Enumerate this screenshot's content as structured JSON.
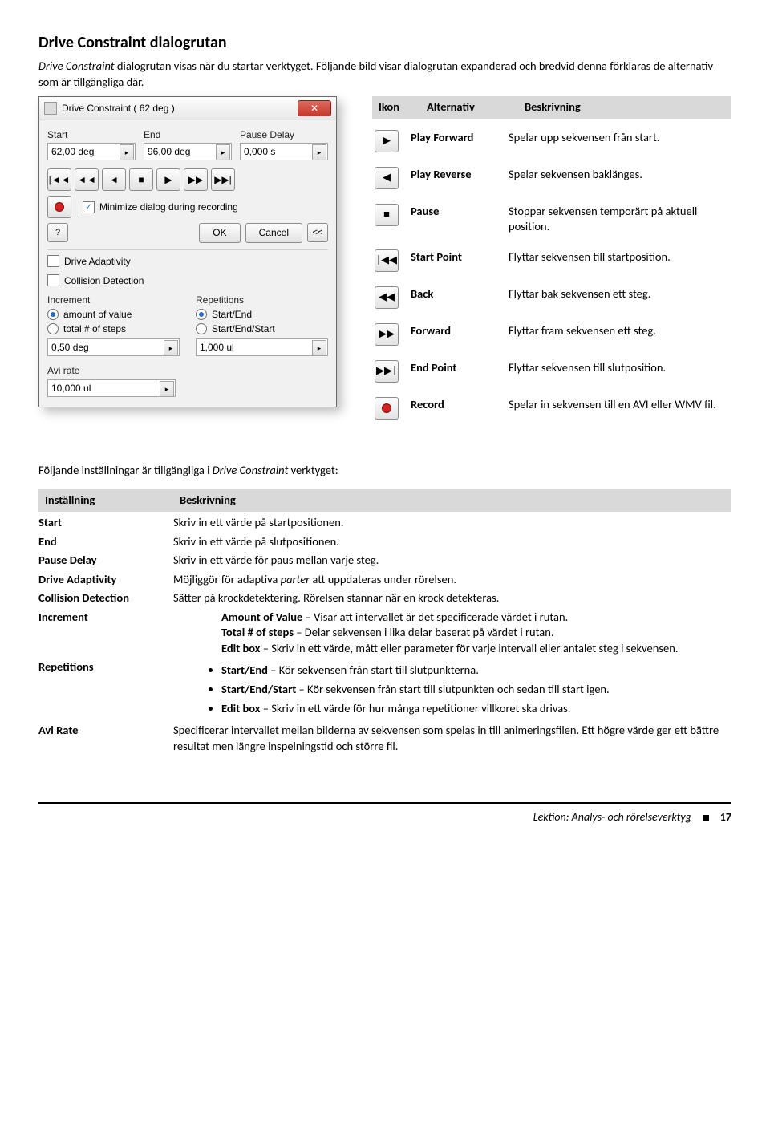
{
  "title": "Drive Constraint dialogrutan",
  "intro_a": "Drive Constraint",
  "intro_b": " dialogrutan visas när du startar verktyget. Följande bild visar dialogrutan expanderad och bredvid denna förklaras de alternativ som är tillgängliga där.",
  "dialog": {
    "title": "Drive Constraint   ( 62 deg )",
    "start_lbl": "Start",
    "end_lbl": "End",
    "pause_lbl": "Pause Delay",
    "start_val": "62,00 deg",
    "end_val": "96,00 deg",
    "pause_val": "0,000 s",
    "minimize": "Minimize dialog during recording",
    "ok": "OK",
    "cancel": "Cancel",
    "coll_expand": "<<",
    "adaptivity": "Drive Adaptivity",
    "collision": "Collision Detection",
    "increment": "Increment",
    "repetitions": "Repetitions",
    "amount": "amount of value",
    "total_steps": "total # of steps",
    "start_end": "Start/End",
    "start_end_start": "Start/End/Start",
    "inc_val": "0,50 deg",
    "rep_val": "1,000 ul",
    "avi_rate": "Avi rate",
    "avi_val": "10,000 ul"
  },
  "icon_head": {
    "c1": "Ikon",
    "c2": "Alternativ",
    "c3": "Beskrivning"
  },
  "icons": {
    "play_forward": {
      "label": "Play Forward",
      "desc": "Spelar upp sekvensen från start."
    },
    "play_reverse": {
      "label": "Play Reverse",
      "desc": "Spelar sekvensen baklänges."
    },
    "pause": {
      "label": "Pause",
      "desc": "Stoppar sekvensen temporärt på aktuell position."
    },
    "start_point": {
      "label": "Start Point",
      "desc": "Flyttar sekvensen till startposition."
    },
    "back": {
      "label": "Back",
      "desc": "Flyttar bak sekvensen ett steg."
    },
    "forward": {
      "label": "Forward",
      "desc": "Flyttar fram sekvensen ett steg."
    },
    "end_point": {
      "label": "End Point",
      "desc": "Flyttar sekvensen till slutposition."
    },
    "record": {
      "label": "Record",
      "desc": "Spelar in sekvensen till en AVI eller WMV fil."
    }
  },
  "settings_intro_a": "Följande inställningar är tillgängliga i ",
  "settings_intro_b": "Drive Constraint",
  "settings_intro_c": " verktyget:",
  "set_head": {
    "c1": "Inställning",
    "c2": "Beskrivning"
  },
  "settings": {
    "start": {
      "label": "Start",
      "desc": "Skriv in ett värde på startpositionen."
    },
    "end": {
      "label": "End",
      "desc": "Skriv in ett värde på slutpositionen."
    },
    "pause": {
      "label": "Pause Delay",
      "desc": "Skriv in ett värde för paus mellan varje steg."
    },
    "adapt": {
      "label": "Drive Adaptivity",
      "desc_a": "Möjliggör för adaptiva ",
      "desc_b": "parter",
      "desc_c": " att uppdateras under rörelsen."
    },
    "coll": {
      "label": "Collision Detection",
      "desc": "Sätter på krockdetektering. Rörelsen stannar när en krock detekteras."
    },
    "inc": {
      "label": "Increment",
      "amount_b": "Amount of Value",
      "amount_t": " – Visar att intervallet är det specificerade värdet i rutan.",
      "total_b": "Total # of steps",
      "total_t": " – Delar sekvensen i lika delar baserat på värdet i rutan.",
      "edit_b": "Edit box",
      "edit_t": " – Skriv in ett värde, mått eller parameter för varje intervall eller antalet steg i sekvensen."
    },
    "rep": {
      "label": "Repetitions",
      "se_b": "Start/End",
      "se_t": " – Kör sekvensen från start till slutpunkterna.",
      "ses_b": "Start/End/Start",
      "ses_t": " – Kör sekvensen från start till slutpunkten och sedan till start igen.",
      "ed_b": "Edit box",
      "ed_t": " – Skriv in ett värde för hur många repetitioner villkoret ska drivas."
    },
    "avi": {
      "label": "Avi Rate",
      "desc": "Specificerar intervallet mellan bilderna av sekvensen som spelas in till animeringsfilen. Ett högre värde ger ett bättre resultat men längre inspelningstid och större fil."
    }
  },
  "footer": {
    "text": "Lektion: Analys- och rörelseverktyg",
    "page": "17"
  }
}
